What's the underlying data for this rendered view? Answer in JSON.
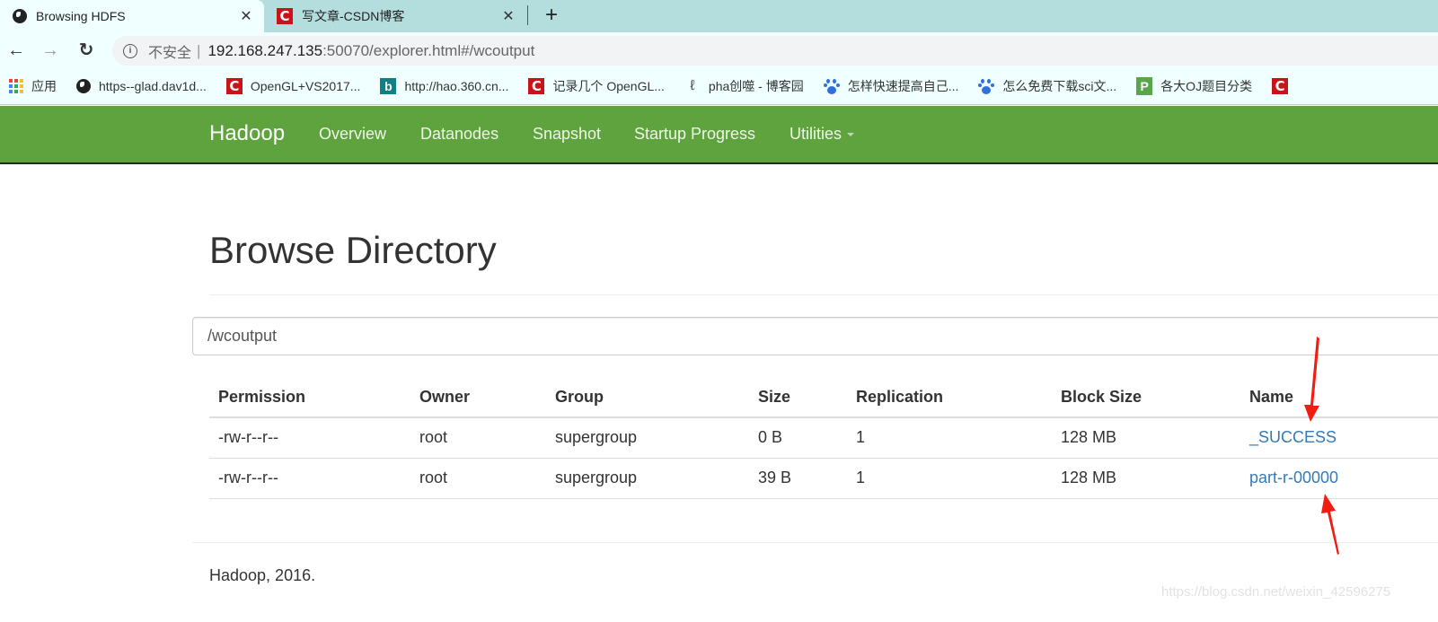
{
  "browser": {
    "tabs": [
      {
        "title": "Browsing HDFS",
        "icon": "globe-icon",
        "active": true
      },
      {
        "title": "写文章-CSDN博客",
        "icon": "csdn-icon",
        "active": false
      }
    ],
    "close_glyph": "✕",
    "new_tab_glyph": "+",
    "nav": {
      "back": "←",
      "forward": "→",
      "reload": "↻"
    },
    "address": {
      "security_label": "不安全",
      "host": "192.168.247.135",
      "rest": ":50070/explorer.html#/wcoutput"
    },
    "bookmarks": [
      {
        "label": "应用",
        "icon": "apps-grid-icon"
      },
      {
        "label": "https--glad.dav1d...",
        "icon": "globe-icon"
      },
      {
        "label": "OpenGL+VS2017...",
        "icon": "csdn-icon"
      },
      {
        "label": "http://hao.360.cn...",
        "icon": "bing-icon"
      },
      {
        "label": "记录几个 OpenGL...",
        "icon": "csdn-icon"
      },
      {
        "label": "pha创噬 - 博客园",
        "icon": "cnblogs-icon"
      },
      {
        "label": "怎样快速提高自己...",
        "icon": "baidu-icon"
      },
      {
        "label": "怎么免费下载sci文...",
        "icon": "baidu-icon"
      },
      {
        "label": "各大OJ题目分类",
        "icon": "p-board-icon"
      },
      {
        "label": "",
        "icon": "csdn-icon"
      }
    ]
  },
  "navbar": {
    "brand": "Hadoop",
    "links": [
      "Overview",
      "Datanodes",
      "Snapshot",
      "Startup Progress",
      "Utilities"
    ],
    "color": "#5fa33e"
  },
  "main": {
    "title": "Browse Directory",
    "path_value": "/wcoutput",
    "table": {
      "columns": [
        "Permission",
        "Owner",
        "Group",
        "Size",
        "Replication",
        "Block Size",
        "Name"
      ],
      "rows": [
        [
          "-rw-r--r--",
          "root",
          "supergroup",
          "0 B",
          "1",
          "128 MB",
          "_SUCCESS"
        ],
        [
          "-rw-r--r--",
          "root",
          "supergroup",
          "39 B",
          "1",
          "128 MB",
          "part-r-00000"
        ]
      ]
    },
    "link_color": "#337ab7"
  },
  "footer": {
    "text": "Hadoop, 2016."
  },
  "watermark": "https://blog.csdn.net/weixin_42596275"
}
